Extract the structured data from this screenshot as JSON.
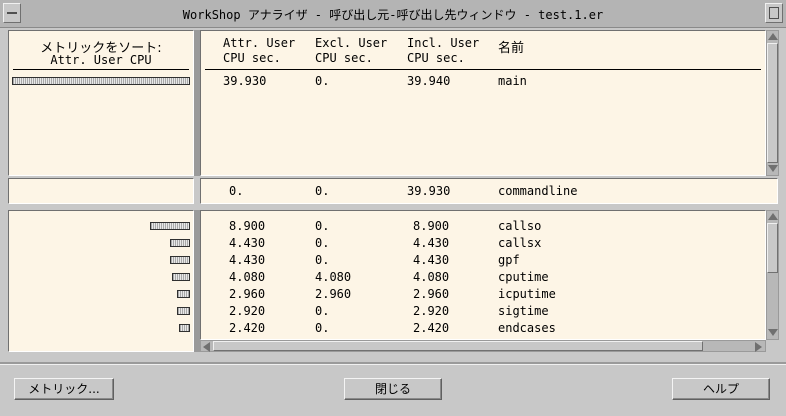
{
  "window": {
    "title": "WorkShop アナライザ - 呼び出し元-呼び出し先ウィンドウ - test.1.er"
  },
  "sort_panel": {
    "label_line1": "メトリックをソート:",
    "label_line2": "Attr. User CPU"
  },
  "columns": [
    {
      "line1": "Attr. User",
      "line2": "CPU sec."
    },
    {
      "line1": "Excl. User",
      "line2": "CPU sec."
    },
    {
      "line1": "Incl. User",
      "line2": "CPU sec."
    },
    {
      "line1": "名前",
      "line2": ""
    }
  ],
  "callers": [
    {
      "attr": "39.930",
      "excl": "0.",
      "incl": "39.940",
      "name": "main",
      "bar_fraction": 1.0
    }
  ],
  "selected": {
    "attr": "0.",
    "excl": "0.",
    "incl": "39.930",
    "name": "commandline"
  },
  "callees": [
    {
      "attr": "8.900",
      "excl": "0.",
      "incl": "8.900",
      "name": "callso",
      "bar_fraction": 0.223
    },
    {
      "attr": "4.430",
      "excl": "0.",
      "incl": "4.430",
      "name": "callsx",
      "bar_fraction": 0.111
    },
    {
      "attr": "4.430",
      "excl": "0.",
      "incl": "4.430",
      "name": "gpf",
      "bar_fraction": 0.111
    },
    {
      "attr": "4.080",
      "excl": "4.080",
      "incl": "4.080",
      "name": "cputime",
      "bar_fraction": 0.102
    },
    {
      "attr": "2.960",
      "excl": "2.960",
      "incl": "2.960",
      "name": "icputime",
      "bar_fraction": 0.074
    },
    {
      "attr": "2.920",
      "excl": "0.",
      "incl": "2.920",
      "name": "sigtime",
      "bar_fraction": 0.073
    },
    {
      "attr": "2.420",
      "excl": "0.",
      "incl": "2.420",
      "name": "endcases",
      "bar_fraction": 0.061
    }
  ],
  "buttons": {
    "metrics": "メトリック...",
    "close": "閉じる",
    "help": "ヘルプ"
  }
}
